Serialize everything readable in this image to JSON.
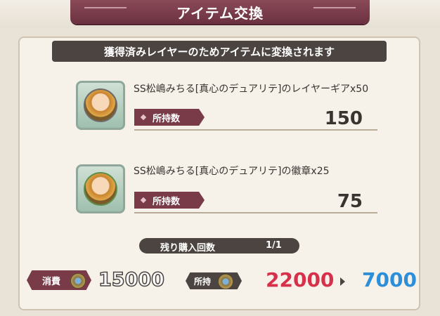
{
  "header": {
    "title": "アイテム交換"
  },
  "subtitle": "獲得済みレイヤーのためアイテムに変換されます",
  "items": [
    {
      "name": "SS松嶋みちる[真心のデュアリテ]のレイヤーギアx50",
      "owned_label": "所持数",
      "owned_value": "150",
      "icon": "gear-portrait-icon"
    },
    {
      "name": "SS松嶋みちる[真心のデュアリテ]の徽章x25",
      "owned_label": "所持数",
      "owned_value": "75",
      "icon": "badge-portrait-icon"
    }
  ],
  "purchase": {
    "remaining_label": "残り購入回数",
    "remaining_value": "1/1"
  },
  "cost": {
    "consume_label": "消費",
    "consume_value": "15000",
    "hold_label": "所持",
    "hold_value": "22000",
    "after_value": "7000",
    "currency_icon": "medal-icon"
  },
  "colors": {
    "accent": "#7a3b49",
    "hold": "#d6304a",
    "after": "#2d8fd9"
  }
}
